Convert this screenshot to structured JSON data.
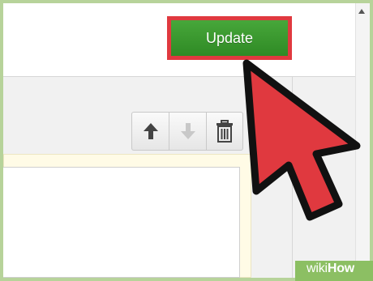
{
  "toolbar": {
    "update_label": "Update",
    "buttons": [
      {
        "icon": "arrow-up-icon",
        "color": "#444444",
        "enabled": true
      },
      {
        "icon": "arrow-down-icon",
        "color": "#c8c8c8",
        "enabled": false
      },
      {
        "icon": "trash-icon",
        "color": "#444444",
        "enabled": true
      }
    ]
  },
  "cursor": {
    "icon": "mouse-pointer-icon",
    "fill": "#e0393f",
    "stroke": "#111111"
  },
  "watermark": {
    "prefix": "wiki",
    "suffix": "How"
  },
  "colors": {
    "update_button": "#3a9a2e",
    "update_highlight": "#e0393f",
    "frame_border": "#b7d39a",
    "editor_bg": "#fffbe6"
  }
}
